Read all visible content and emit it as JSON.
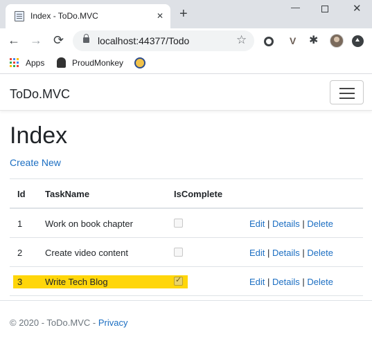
{
  "browser": {
    "tab_title": "Index - ToDo.MVC",
    "tab_close": "✕",
    "new_tab": "+",
    "win_minimize": "—",
    "win_close": "✕",
    "url": "localhost:44377/Todo",
    "bookmarks": [
      {
        "label": "Apps",
        "icon": "apps-grid-icon"
      },
      {
        "label": "ProudMonkey",
        "icon": "monkey-icon"
      },
      {
        "label": "",
        "icon": "globe-icon"
      }
    ],
    "icons": {
      "back": "←",
      "forward": "→",
      "reload": "⟳",
      "star": "☆",
      "puzzle": "✱",
      "ext_v": "V"
    },
    "apps_colors": [
      "#ea4335",
      "#4285f4",
      "#fbbc05",
      "#34a853",
      "#ea4335",
      "#4285f4",
      "#fbbc05",
      "#34a853",
      "#ea4335"
    ]
  },
  "navbar": {
    "brand": "ToDo.MVC"
  },
  "page": {
    "title": "Index",
    "create_link": "Create New"
  },
  "table": {
    "headers": [
      "Id",
      "TaskName",
      "IsComplete"
    ],
    "rows": [
      {
        "id": "1",
        "task": "Work on book chapter",
        "complete": false
      },
      {
        "id": "2",
        "task": "Create video content",
        "complete": false
      },
      {
        "id": "3",
        "task": "Write Tech Blog",
        "complete": true,
        "highlighted": true
      }
    ],
    "actions": {
      "edit": "Edit",
      "details": "Details",
      "delete": "Delete",
      "sep": "|"
    }
  },
  "footer": {
    "prefix": "© 2020 - ToDo.MVC - ",
    "privacy": "Privacy"
  },
  "colors": {
    "link": "#1b6ec2",
    "highlight": "#ffd60a"
  }
}
